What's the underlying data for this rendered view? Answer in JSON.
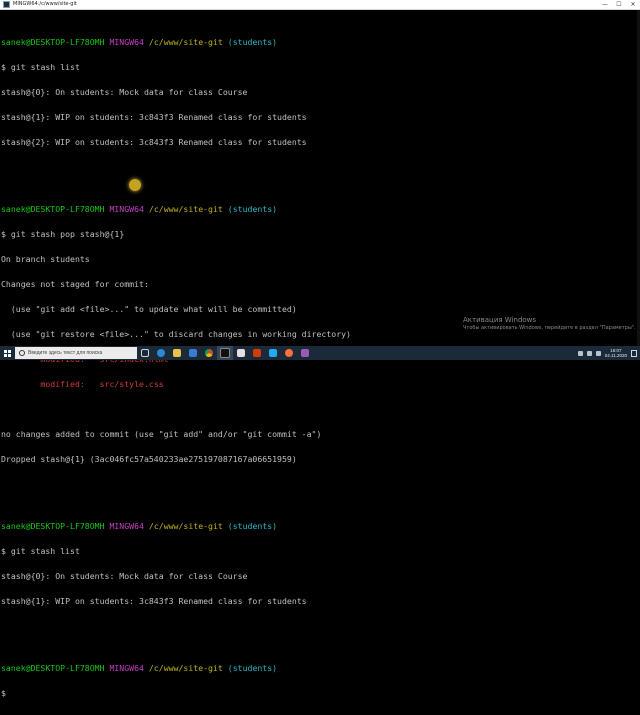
{
  "window": {
    "title": "MINGW64:/c/www/site-git",
    "controls": {
      "minimize": "—",
      "maximize": "☐",
      "close": "✕"
    }
  },
  "prompt": {
    "user_host": "sanek@DESKTOP-LF78OMH",
    "env": "MINGW64",
    "path": "/c/www/site-git",
    "branch": "(students)",
    "symbol": "$"
  },
  "terminal": {
    "cmd1": "git stash list",
    "out1": [
      "stash@{0}: On students: Mock data for class Course",
      "stash@{1}: WIP on students: 3c843f3 Renamed class for students",
      "stash@{2}: WIP on students: 3c843f3 Renamed class for students"
    ],
    "cmd2": "git stash pop stash@{1}",
    "out2": [
      "On branch students",
      "Changes not staged for commit:",
      "  (use \"git add <file>...\" to update what will be committed)",
      "  (use \"git restore <file>...\" to discard changes in working directory)"
    ],
    "modified": [
      {
        "label": "        modified:",
        "file": "   src/index.html"
      },
      {
        "label": "        modified:",
        "file": "   src/style.css"
      }
    ],
    "out3": [
      "no changes added to commit (use \"git add\" and/or \"git commit -a\")",
      "Dropped stash@{1} (3ac046fc57a540233ae275197087167a06651959)"
    ],
    "cmd3": "git stash list",
    "out4": [
      "stash@{0}: On students: Mock data for class Course",
      "stash@{1}: WIP on students: 3c843f3 Renamed class for students"
    ]
  },
  "activation": {
    "title": "Активация Windows",
    "subtitle": "Чтобы активировать Windows, перейдите в раздел \"Параметры\"."
  },
  "taskbar": {
    "search_placeholder": "Введите здесь текст для поиска",
    "icons": [
      "task-view",
      "edge",
      "explorer",
      "store",
      "chrome",
      "terminal",
      "mail",
      "office",
      "vscode",
      "firefox",
      "paint"
    ],
    "clock_time": "16:07",
    "clock_date": "04.11.2020"
  }
}
